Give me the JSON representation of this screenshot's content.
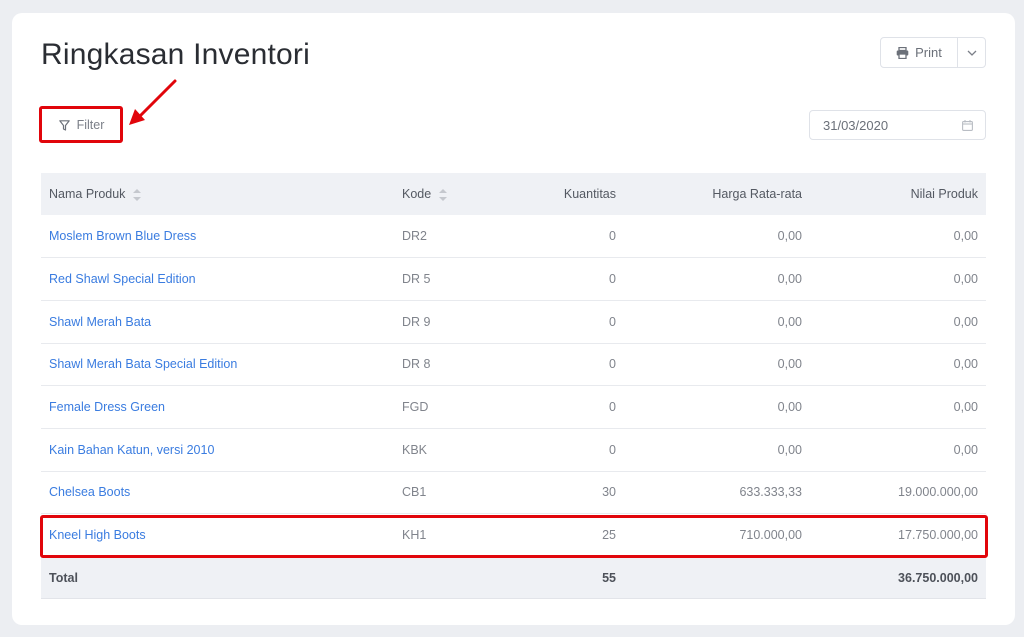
{
  "page": {
    "title": "Ringkasan Inventori"
  },
  "toolbar": {
    "print_label": "Print",
    "print_icon": "printer-icon",
    "print_dropdown_icon": "chevron-down-icon",
    "filter_label": "Filter",
    "filter_icon": "funnel-icon",
    "date_value": "31/03/2020",
    "date_icon": "calendar-icon"
  },
  "table": {
    "columns": [
      {
        "label": "Nama Produk",
        "sortable": true
      },
      {
        "label": "Kode",
        "sortable": true
      },
      {
        "label": "Kuantitas",
        "sortable": false
      },
      {
        "label": "Harga Rata-rata",
        "sortable": false
      },
      {
        "label": "Nilai Produk",
        "sortable": false
      }
    ],
    "rows": [
      {
        "name": "Moslem Brown Blue Dress",
        "code": "DR2",
        "qty": "0",
        "avg_price": "0,00",
        "value": "0,00"
      },
      {
        "name": "Red Shawl Special Edition",
        "code": "DR 5",
        "qty": "0",
        "avg_price": "0,00",
        "value": "0,00"
      },
      {
        "name": "Shawl Merah Bata",
        "code": "DR 9",
        "qty": "0",
        "avg_price": "0,00",
        "value": "0,00"
      },
      {
        "name": "Shawl Merah Bata Special Edition",
        "code": "DR 8",
        "qty": "0",
        "avg_price": "0,00",
        "value": "0,00"
      },
      {
        "name": "Female Dress Green",
        "code": "FGD",
        "qty": "0",
        "avg_price": "0,00",
        "value": "0,00"
      },
      {
        "name": "Kain Bahan Katun, versi 2010",
        "code": "KBK",
        "qty": "0",
        "avg_price": "0,00",
        "value": "0,00"
      },
      {
        "name": "Chelsea Boots",
        "code": "CB1",
        "qty": "30",
        "avg_price": "633.333,33",
        "value": "19.000.000,00"
      },
      {
        "name": "Kneel High Boots",
        "code": "KH1",
        "qty": "25",
        "avg_price": "710.000,00",
        "value": "17.750.000,00"
      }
    ],
    "footer": {
      "label": "Total",
      "qty": "55",
      "value": "36.750.000,00"
    }
  },
  "annotations": {
    "highlight_color": "#e1050b",
    "highlighted": [
      "filter-button",
      "row-Kneel High Boots"
    ]
  },
  "colors": {
    "link": "#3a7ce0",
    "background": "#eceef2",
    "header_bg": "#eff1f5"
  }
}
